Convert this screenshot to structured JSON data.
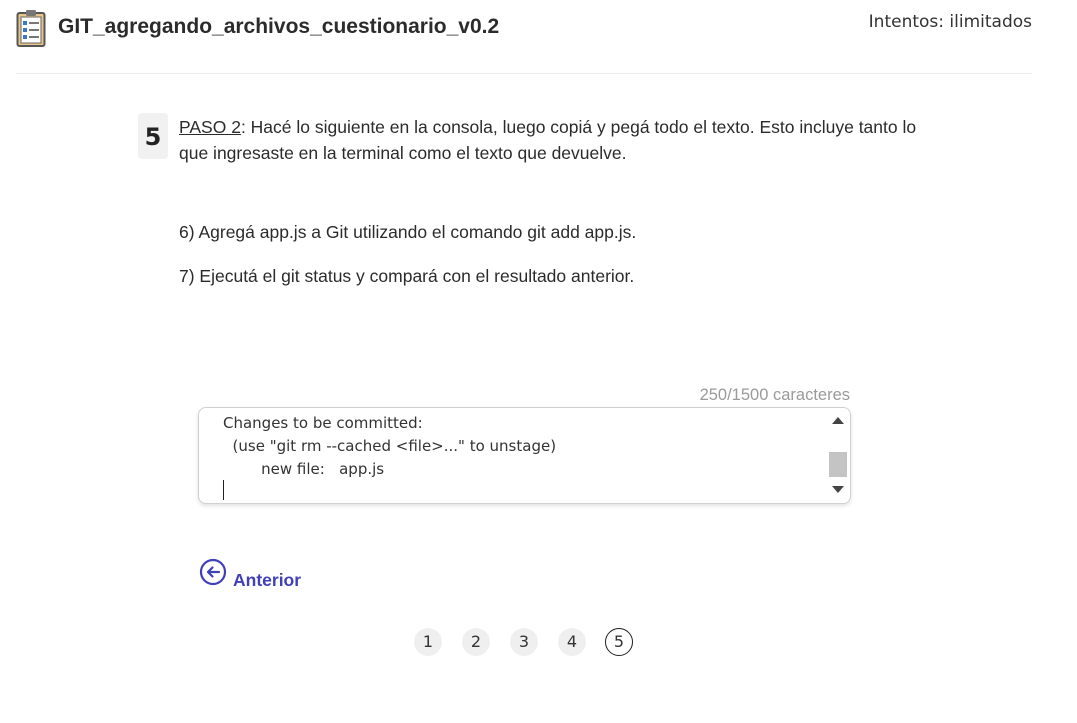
{
  "header": {
    "title": "GIT_agregando_archivos_cuestionario_v0.2",
    "attempts": "Intentos: ilimitados"
  },
  "question": {
    "number": "5",
    "step_label": "PASO 2",
    "prompt_rest": ": Hacé lo siguiente en la consola, luego copiá y pegá todo el texto. Esto incluye tanto lo que ingresaste en la terminal como el texto que devuelve.",
    "instructions": [
      "6) Agregá app.js a Git utilizando el comando git add app.js.",
      "7) Ejecutá el git status y compará con el resultado anterior."
    ]
  },
  "answer": {
    "counter": "250/1500 caracteres",
    "text": "Changes to be committed:\n  (use \"git rm --cached <file>...\" to unstage)\n        new file:   app.js"
  },
  "navigation": {
    "prev_label": "Anterior",
    "pages": [
      "1",
      "2",
      "3",
      "4",
      "5"
    ],
    "current_page": "5"
  },
  "colors": {
    "accent": "#4040b8",
    "page_bg": "#efefef"
  }
}
